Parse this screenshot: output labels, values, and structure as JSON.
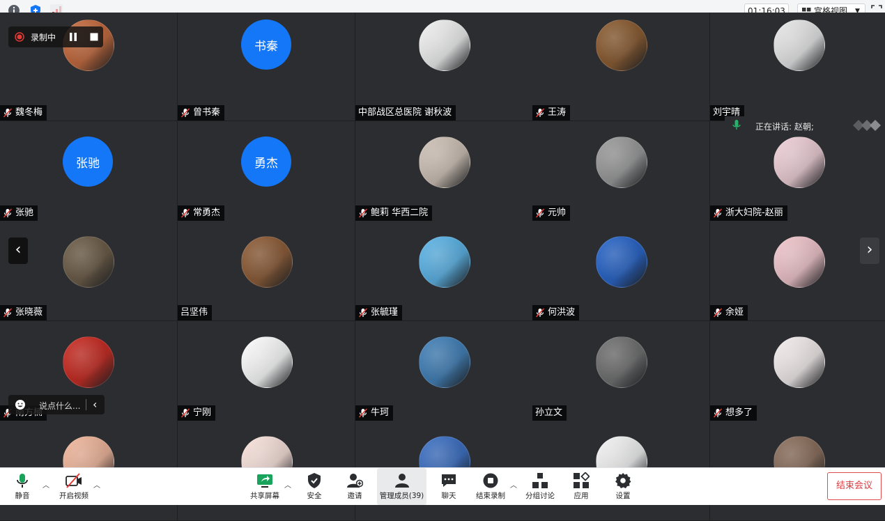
{
  "topbar": {
    "timer": "01:16:03",
    "view_label": "宫格视图",
    "icons": [
      "info-icon",
      "shield-icon",
      "signal-icon",
      "grid-icon",
      "chevron-down-icon",
      "fullscreen-icon"
    ]
  },
  "recording": {
    "label": "录制中"
  },
  "speaking": {
    "label": "正在讲话: 赵朝;"
  },
  "chat": {
    "placeholder": "说点什么..."
  },
  "participants": [
    {
      "name": "魏冬梅",
      "muted": true,
      "avatar": "photo",
      "color": "#c4683a"
    },
    {
      "name": "曾书秦",
      "muted": true,
      "avatar": "text",
      "avatar_text": "书秦"
    },
    {
      "name": "中部战区总医院 谢秋波",
      "muted": false,
      "avatar": "photo",
      "color": "#f2f2f2"
    },
    {
      "name": "王涛",
      "muted": true,
      "avatar": "photo",
      "color": "#8a5a2e"
    },
    {
      "name": "刘宇晴",
      "muted": false,
      "avatar": "photo",
      "color": "#e9e9e9"
    },
    {
      "name": "张驰",
      "muted": true,
      "avatar": "text",
      "avatar_text": "张驰"
    },
    {
      "name": "常勇杰",
      "muted": true,
      "avatar": "text",
      "avatar_text": "勇杰"
    },
    {
      "name": "鲍莉 华西二院",
      "muted": true,
      "avatar": "photo",
      "color": "#cfc2b6"
    },
    {
      "name": "元帅",
      "muted": true,
      "avatar": "photo",
      "color": "#9a9a9a"
    },
    {
      "name": "浙大妇院-赵丽",
      "muted": true,
      "avatar": "photo",
      "color": "#f0d0d8"
    },
    {
      "name": "张晓薇",
      "muted": true,
      "avatar": "photo",
      "color": "#6a5a44"
    },
    {
      "name": "吕坚伟",
      "muted": false,
      "avatar": "photo",
      "color": "#8c5a34"
    },
    {
      "name": "张毓瑾",
      "muted": true,
      "avatar": "photo",
      "color": "#5ab4e8"
    },
    {
      "name": "何洪波",
      "muted": true,
      "avatar": "photo",
      "color": "#2563c8"
    },
    {
      "name": "余娅",
      "muted": true,
      "avatar": "photo",
      "color": "#f2c6cc"
    },
    {
      "name": "南方楠",
      "muted": true,
      "avatar": "photo",
      "color": "#c8281e"
    },
    {
      "name": "宁刚",
      "muted": true,
      "avatar": "photo",
      "color": "#ffffff"
    },
    {
      "name": "牛珂",
      "muted": true,
      "avatar": "photo",
      "color": "#3f7fb8"
    },
    {
      "name": "孙立文",
      "muted": false,
      "avatar": "photo",
      "color": "#6f6f6f"
    },
    {
      "name": "想多了",
      "muted": true,
      "avatar": "photo",
      "color": "#f5eeee"
    },
    {
      "name": "",
      "muted": false,
      "avatar": "photo",
      "color": "#f2b69a"
    },
    {
      "name": "",
      "muted": false,
      "avatar": "photo",
      "color": "#fbe3dc"
    },
    {
      "name": "",
      "muted": false,
      "avatar": "photo",
      "color": "#3a6fc4"
    },
    {
      "name": "",
      "muted": false,
      "avatar": "photo",
      "color": "#f5f5f5"
    },
    {
      "name": "",
      "muted": false,
      "avatar": "photo",
      "color": "#8a6d5a"
    }
  ],
  "toolbar": {
    "mute": "静音",
    "video": "开启视频",
    "share": "共享屏幕",
    "security": "安全",
    "invite": "邀请",
    "members": "管理成员(39)",
    "chat": "聊天",
    "end_record": "结束录制",
    "breakout": "分组讨论",
    "apps": "应用",
    "settings": "设置",
    "end_meeting": "结束会议"
  },
  "colors": {
    "accent": "#1477f8",
    "danger": "#e0393e",
    "record": "#e53935"
  }
}
